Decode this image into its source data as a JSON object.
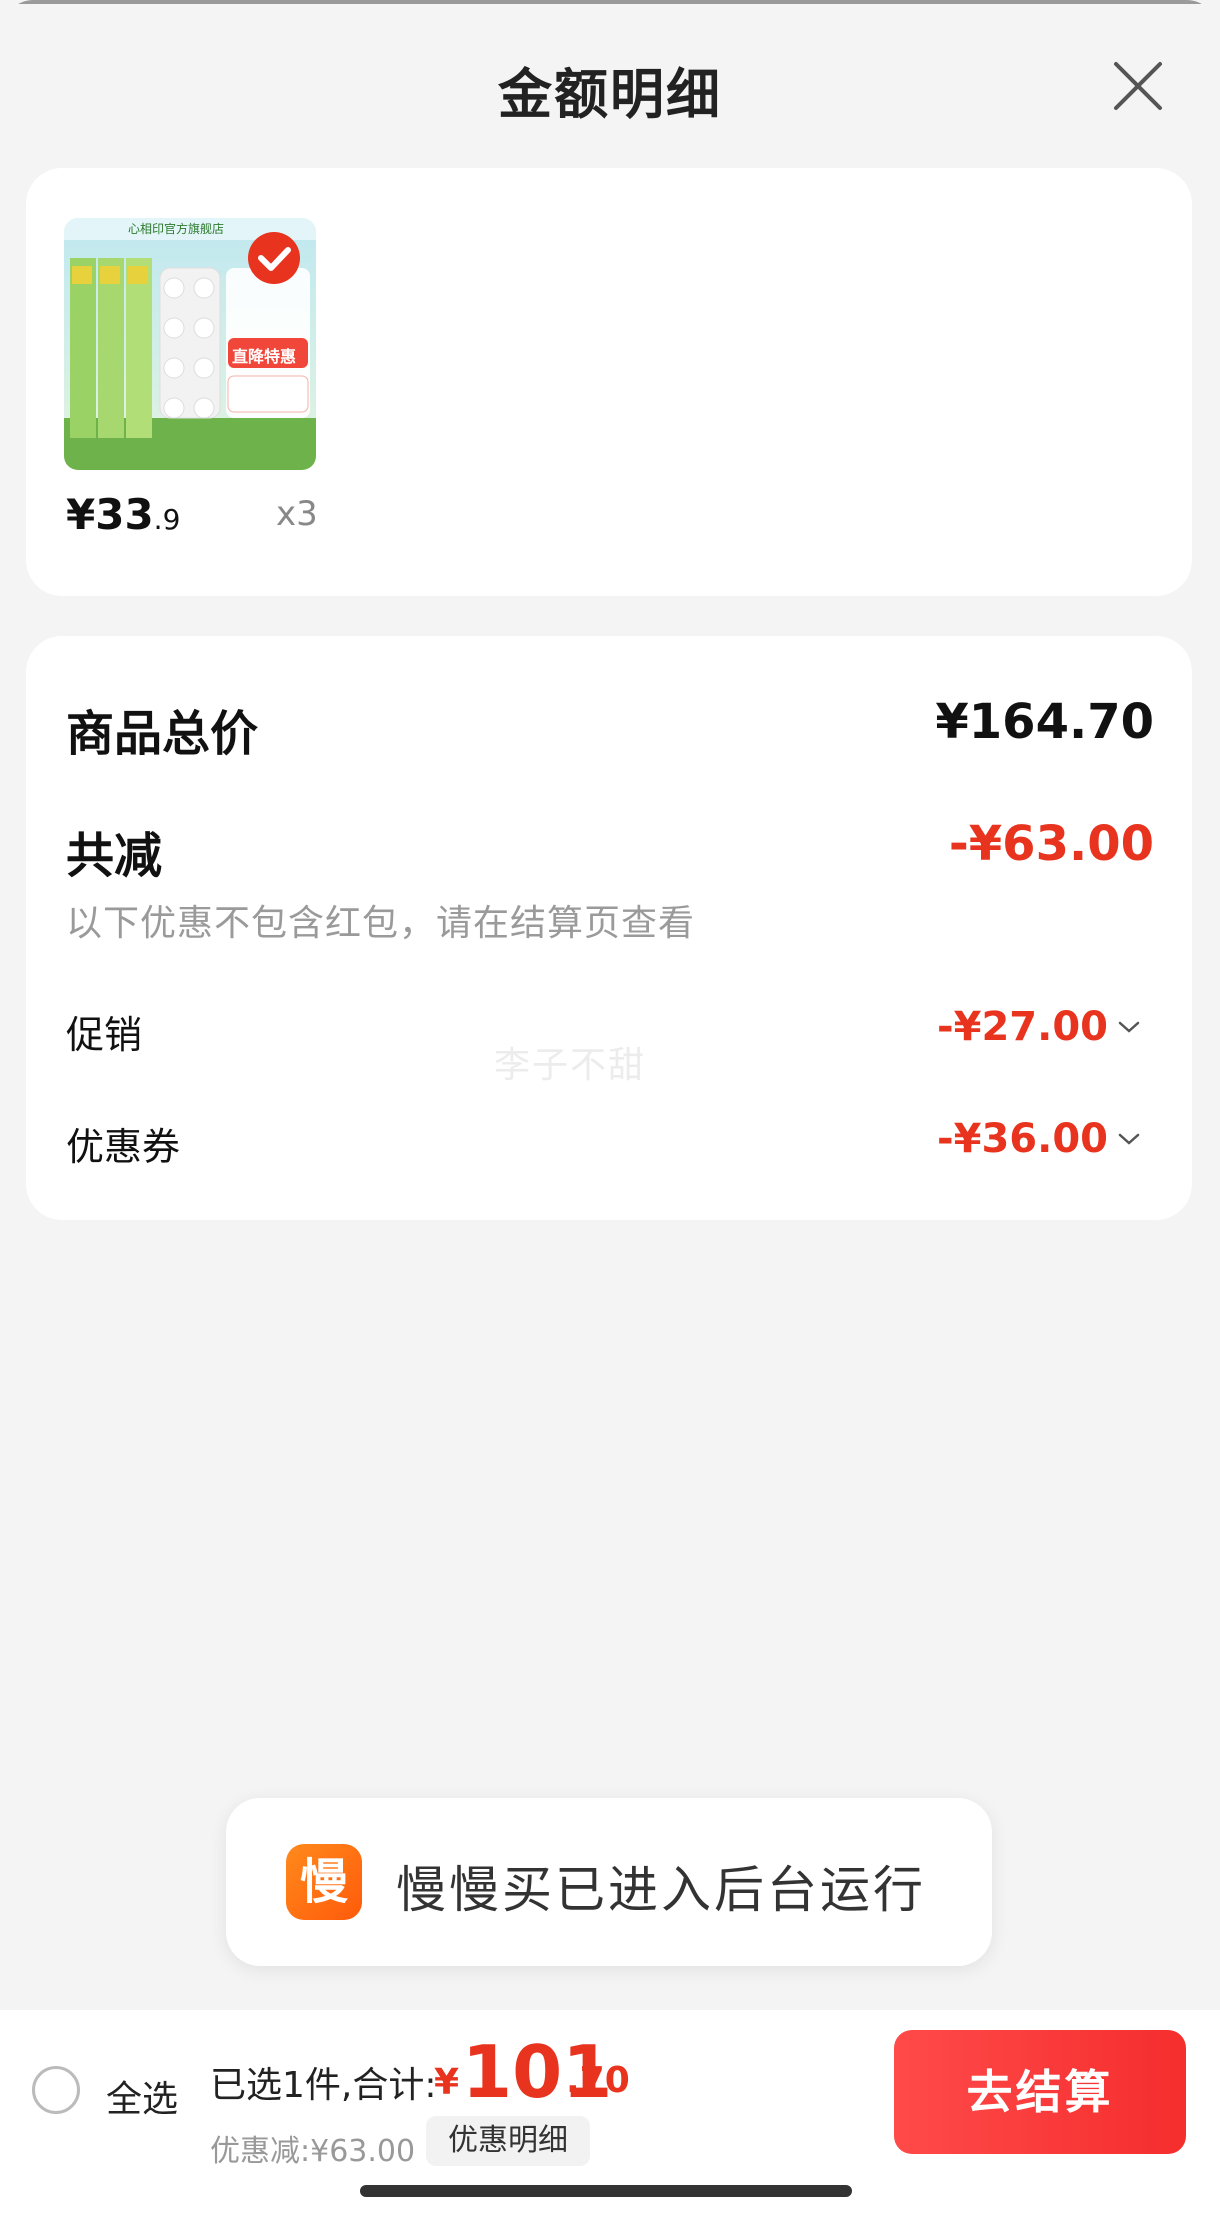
{
  "header": {
    "title": "金额明细"
  },
  "product": {
    "store_label": "心相印官方旗舰店",
    "badge_1": "直降特惠",
    "price_int": "¥33",
    "price_dec": ".9",
    "quantity": "x3"
  },
  "details": {
    "total_label": "商品总价",
    "total_value": "¥164.70",
    "reduce_label": "共减",
    "reduce_value": "-¥63.00",
    "note": "以下优惠不包含红包，请在结算页查看",
    "promo_label": "促销",
    "promo_value": "-¥27.00",
    "coupon_label": "优惠券",
    "coupon_value": "-¥36.00",
    "watermark": "李子不甜"
  },
  "toast": {
    "icon_char": "慢",
    "message": "慢慢买已进入后台运行"
  },
  "bottom": {
    "select_all": "全选",
    "selected_text": "已选1件,合计:",
    "currency": "¥",
    "total_int": "101",
    "total_dec": ".70",
    "discount_text": "优惠减:¥63.00",
    "detail_chip": "优惠明细",
    "checkout": "去结算"
  },
  "colors": {
    "accent_red": "#e8331f",
    "button_red": "#f52d2d",
    "toast_orange": "#ff7a12"
  }
}
